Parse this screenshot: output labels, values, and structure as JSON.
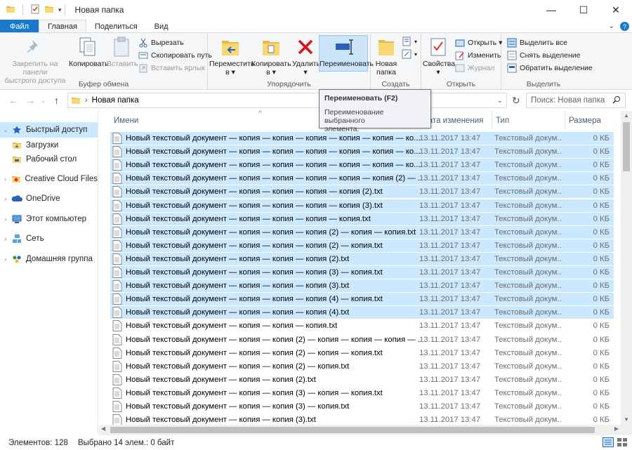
{
  "window": {
    "title": "Новая папка"
  },
  "ribbon_tabs": [
    "Файл",
    "Главная",
    "Поделиться",
    "Вид"
  ],
  "ribbon": {
    "clipboard": {
      "label": "Буфер обмена",
      "pin_line1": "Закрепить на панели",
      "pin_line2": "быстрого доступа",
      "copy": "Копировать",
      "paste": "Вставить",
      "cut": "Вырезать",
      "copy_path": "Скопировать путь",
      "paste_shortcut": "Вставить ярлык"
    },
    "organize": {
      "label": "Упорядочить",
      "move_line1": "Переместить",
      "move_line2": "в ▾",
      "copyto_line1": "Копировать",
      "copyto_line2": "в ▾",
      "delete_line1": "Удалить",
      "delete_line2": "▾",
      "rename": "Переименовать"
    },
    "new": {
      "label": "Создать",
      "newfolder_line1": "Новая",
      "newfolder_line2": "папка"
    },
    "open": {
      "label": "Открыть",
      "props_line1": "Свойства",
      "props_line2": "▾",
      "open": "Открыть ▾",
      "edit": "Изменить",
      "history": "Журнал"
    },
    "select": {
      "label": "Выделить",
      "select_all": "Выделить все",
      "select_none": "Снять выделение",
      "invert": "Обратить выделение"
    }
  },
  "address": {
    "path": "Новая папка",
    "search_placeholder": "Поиск: Новая папка"
  },
  "tooltip": {
    "title": "Переименовать (F2)",
    "desc_line1": "Переименование выбранного",
    "desc_line2": "элемента."
  },
  "nav": [
    {
      "label": "Быстрый доступ",
      "icon": "star-icon"
    },
    {
      "label": "Загрузки",
      "icon": "downloads-icon"
    },
    {
      "label": "Рабочий стол",
      "icon": "desktop-icon"
    },
    {
      "label": "Creative Cloud Files",
      "icon": "creative-cloud-icon"
    },
    {
      "label": "OneDrive",
      "icon": "onedrive-icon"
    },
    {
      "label": "Этот компьютер",
      "icon": "computer-icon"
    },
    {
      "label": "Сеть",
      "icon": "network-icon"
    },
    {
      "label": "Домашняя группа",
      "icon": "homegroup-icon"
    }
  ],
  "columns": [
    "Имени",
    "Дата изменения",
    "Тип",
    "Размера"
  ],
  "files": [
    {
      "name": "Новый текстовый документ — копия — копия — копия — копия — копия — ко...",
      "date": "13.11.2017 13:47",
      "type": "Текстовый докум...",
      "size": "0 КБ",
      "selected": true
    },
    {
      "name": "Новый текстовый документ — копия — копия — копия — копия — копия — ко...",
      "date": "13.11.2017 13:47",
      "type": "Текстовый докум...",
      "size": "0 КБ",
      "selected": true
    },
    {
      "name": "Новый текстовый документ — копия — копия — копия — копия — копия — ко...",
      "date": "13.11.2017 13:47",
      "type": "Текстовый докум...",
      "size": "0 КБ",
      "selected": true
    },
    {
      "name": "Новый текстовый документ — копия — копия — копия — копия — копия (2) — ...",
      "date": "13.11.2017 13:47",
      "type": "Текстовый докум...",
      "size": "0 КБ",
      "selected": true
    },
    {
      "name": "Новый текстовый документ — копия — копия — копия — копия (2).txt",
      "date": "13.11.2017 13:47",
      "type": "Текстовый докум...",
      "size": "0 КБ",
      "selected": true
    },
    {
      "name": "Новый текстовый документ — копия — копия — копия — копия (3).txt",
      "date": "13.11.2017 13:47",
      "type": "Текстовый докум...",
      "size": "0 КБ",
      "selected": true
    },
    {
      "name": "Новый текстовый документ — копия — копия — копия — копия.txt",
      "date": "13.11.2017 13:47",
      "type": "Текстовый докум...",
      "size": "0 КБ",
      "selected": true
    },
    {
      "name": "Новый текстовый документ — копия — копия — копия (2) — копия — копия.txt",
      "date": "13.11.2017 13:47",
      "type": "Текстовый докум...",
      "size": "0 КБ",
      "selected": true
    },
    {
      "name": "Новый текстовый документ — копия — копия — копия (2) — копия.txt",
      "date": "13.11.2017 13:47",
      "type": "Текстовый докум...",
      "size": "0 КБ",
      "selected": true
    },
    {
      "name": "Новый текстовый документ — копия — копия — копия (2).txt",
      "date": "13.11.2017 13:47",
      "type": "Текстовый докум...",
      "size": "0 КБ",
      "selected": true
    },
    {
      "name": "Новый текстовый документ — копия — копия — копия (3) — копия.txt",
      "date": "13.11.2017 13:47",
      "type": "Текстовый докум...",
      "size": "0 КБ",
      "selected": true
    },
    {
      "name": "Новый текстовый документ — копия — копия — копия (3).txt",
      "date": "13.11.2017 13:47",
      "type": "Текстовый докум...",
      "size": "0 КБ",
      "selected": true
    },
    {
      "name": "Новый текстовый документ — копия — копия — копия (4) — копия.txt",
      "date": "13.11.2017 13:47",
      "type": "Текстовый докум...",
      "size": "0 КБ",
      "selected": true
    },
    {
      "name": "Новый текстовый документ — копия — копия — копия (4).txt",
      "date": "13.11.2017 13:47",
      "type": "Текстовый докум...",
      "size": "0 КБ",
      "selected": true
    },
    {
      "name": "Новый текстовый документ — копия — копия — копия.txt",
      "date": "13.11.2017 13:47",
      "type": "Текстовый докум...",
      "size": "0 КБ",
      "selected": false
    },
    {
      "name": "Новый текстовый документ — копия — копия (2) — копия — копия — копия — ...",
      "date": "13.11.2017 13:47",
      "type": "Текстовый докум...",
      "size": "0 КБ",
      "selected": false
    },
    {
      "name": "Новый текстовый документ — копия — копия (2) — копия — копия.txt",
      "date": "13.11.2017 13:47",
      "type": "Текстовый докум...",
      "size": "0 КБ",
      "selected": false
    },
    {
      "name": "Новый текстовый документ — копия — копия (2) — копия.txt",
      "date": "13.11.2017 13:47",
      "type": "Текстовый докум...",
      "size": "0 КБ",
      "selected": false
    },
    {
      "name": "Новый текстовый документ — копия — копия (2).txt",
      "date": "13.11.2017 13:47",
      "type": "Текстовый докум...",
      "size": "0 КБ",
      "selected": false
    },
    {
      "name": "Новый текстовый документ — копия — копия (3) — копия — копия.txt",
      "date": "13.11.2017 13:47",
      "type": "Текстовый докум...",
      "size": "0 КБ",
      "selected": false
    },
    {
      "name": "Новый текстовый документ — копия — копия (3) — копия.txt",
      "date": "13.11.2017 13:47",
      "type": "Текстовый докум...",
      "size": "0 КБ",
      "selected": false
    },
    {
      "name": "Новый текстовый документ — копия — копия (3).txt",
      "date": "13.11.2017 13:47",
      "type": "Текстовый докум...",
      "size": "0 КБ",
      "selected": false
    }
  ],
  "status": {
    "count": "Элементов: 128",
    "selected": "Выбрано 14 элем.: 0 байт"
  },
  "colors": {
    "accent": "#1979ca",
    "selection": "#cce8ff",
    "folder": "#f8d775"
  }
}
